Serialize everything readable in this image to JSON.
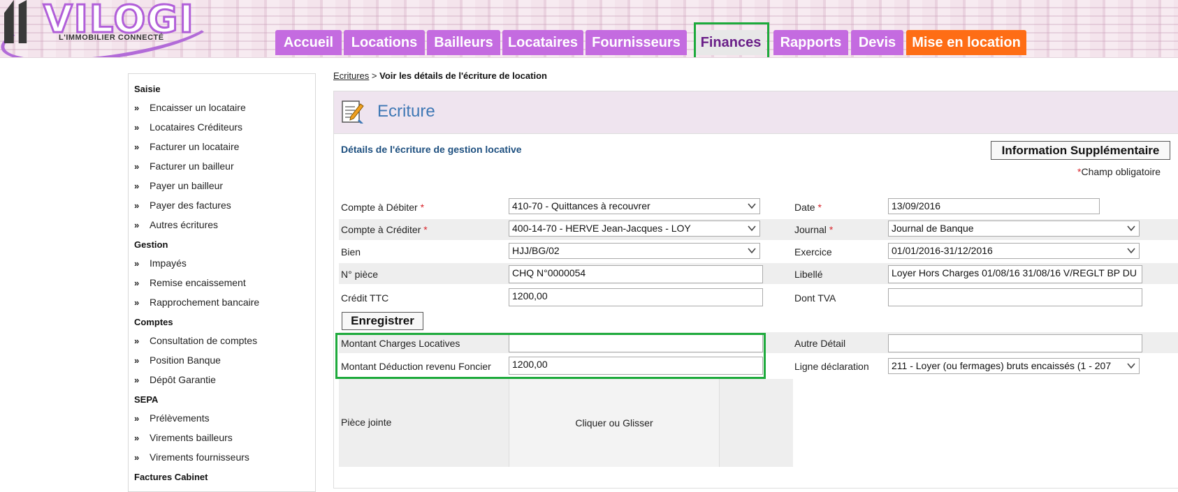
{
  "brand": {
    "name": "VILOGI",
    "tagline": "L'IMMOBILIER CONNECTÉ"
  },
  "nav": {
    "tabs": [
      {
        "label": "Accueil"
      },
      {
        "label": "Locations"
      },
      {
        "label": "Bailleurs"
      },
      {
        "label": "Locataires"
      },
      {
        "label": "Fournisseurs"
      },
      {
        "label": "Finances"
      },
      {
        "label": "Rapports"
      },
      {
        "label": "Devis"
      },
      {
        "label": "Mise en location"
      }
    ],
    "active": "Finances"
  },
  "sidebar": {
    "sections": [
      {
        "title": "Saisie",
        "items": [
          "Encaisser un locataire",
          "Locataires Créditeurs",
          "Facturer un locataire",
          "Facturer un bailleur",
          "Payer un bailleur",
          "Payer des factures",
          "Autres écritures"
        ]
      },
      {
        "title": "Gestion",
        "items": [
          "Impayés",
          "Remise encaissement",
          "Rapprochement bancaire"
        ]
      },
      {
        "title": "Comptes",
        "items": [
          "Consultation de comptes",
          "Position Banque",
          "Dépôt Garantie"
        ]
      },
      {
        "title": "SEPA",
        "items": [
          "Prélèvements",
          "Virements bailleurs",
          "Virements fournisseurs"
        ]
      },
      {
        "title": "Factures Cabinet",
        "items": []
      }
    ],
    "bullet": "»"
  },
  "breadcrumb": {
    "link": "Ecritures",
    "separator": ">",
    "current": "Voir les détails de l'écriture de location"
  },
  "panel": {
    "title": "Ecriture",
    "subtitle": "Détails de l'écriture de gestion locative",
    "info_button": "Information Supplémentaire",
    "required_note": "Champ obligatoire",
    "required_star": "*"
  },
  "form": {
    "compte_debiter": {
      "label": "Compte à Débiter",
      "value": "410-70 - Quittances à recouvrer"
    },
    "compte_crediter": {
      "label": "Compte à Créditer",
      "value": "400-14-70 - HERVE Jean-Jacques - LOY"
    },
    "bien": {
      "label": "Bien",
      "value": "HJJ/BG/02"
    },
    "piece": {
      "label": "N° pièce",
      "value": "CHQ N°0000054"
    },
    "credit_ttc": {
      "label": "Crédit TTC",
      "value": "1200,00"
    },
    "date": {
      "label": "Date",
      "value": "13/09/2016"
    },
    "journal": {
      "label": "Journal",
      "value": "Journal de Banque"
    },
    "exercice": {
      "label": "Exercice",
      "value": "01/01/2016-31/12/2016"
    },
    "libelle": {
      "label": "Libellé",
      "value": "Loyer Hors Charges 01/08/16 31/08/16 V/REGLT BP DU"
    },
    "dont_tva": {
      "label": "Dont TVA",
      "value": ""
    },
    "save_button": "Enregistrer",
    "montant_charges": {
      "label": "Montant Charges Locatives",
      "value": ""
    },
    "montant_deduction": {
      "label": "Montant Déduction revenu Foncier",
      "value": "1200,00"
    },
    "autre_detail": {
      "label": "Autre Détail",
      "value": ""
    },
    "ligne_declaration": {
      "label": "Ligne déclaration",
      "value": "211 - Loyer (ou fermages) bruts encaissés (1 - 207"
    },
    "piece_jointe": {
      "label": "Pièce jointe",
      "drop_text": "Cliquer ou Glisser"
    }
  },
  "colors": {
    "tab_purple": "#c46be0",
    "tab_orange": "#fe6d15",
    "highlight_green": "#1eaa3c",
    "title_blue": "#3f78b5"
  }
}
